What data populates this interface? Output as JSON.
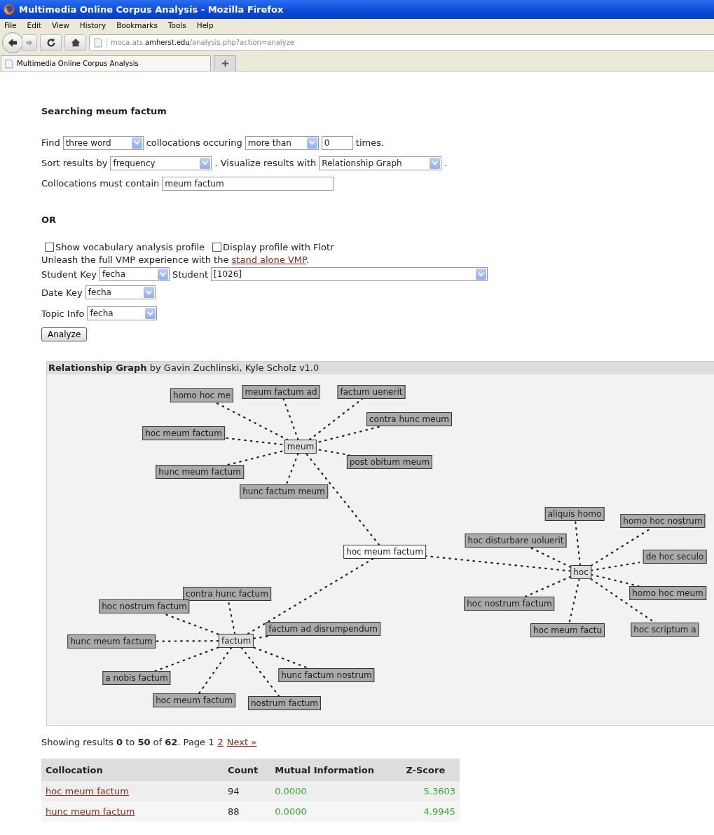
{
  "window": {
    "title": "Multimedia Online Corpus Analysis - Mozilla Firefox"
  },
  "menu": [
    {
      "label": "File"
    },
    {
      "label": "Edit"
    },
    {
      "label": "View"
    },
    {
      "label": "History"
    },
    {
      "label": "Bookmarks"
    },
    {
      "label": "Tools"
    },
    {
      "label": "Help"
    }
  ],
  "address_bar": {
    "host_prefix": "moca.ats.",
    "domain": "amherst.edu",
    "path": "/analysis.php?action=analyze"
  },
  "tabs": [
    {
      "label": "Multimedia Online Corpus Analysis",
      "selected": true
    }
  ],
  "heading": "Searching meum factum",
  "query_rows": [
    [
      {
        "kind": "text",
        "text": "Find"
      },
      {
        "kind": "select",
        "value": "three word"
      },
      {
        "kind": "text",
        "text": "collocations occuring"
      },
      {
        "kind": "select",
        "value": "more than"
      },
      {
        "kind": "input",
        "value": "0"
      },
      {
        "kind": "text",
        "text": "times."
      }
    ],
    [
      {
        "kind": "text",
        "text": "Sort results by"
      },
      {
        "kind": "select",
        "value": "frequency"
      },
      {
        "kind": "text",
        "text": ". Visualize results with"
      },
      {
        "kind": "select",
        "value": "Relationship Graph"
      },
      {
        "kind": "text",
        "text": "."
      }
    ],
    [
      {
        "kind": "text",
        "text": "Collocations must contain"
      },
      {
        "kind": "input",
        "value": "meum factum"
      }
    ]
  ],
  "or_label": "OR",
  "checkboxes": [
    {
      "label": "Show vocabulary analysis profile",
      "checked": false
    },
    {
      "label": "Display profile with Flotr",
      "checked": false
    }
  ],
  "vmp_note": {
    "text": "Unleash the full VMP experience with the",
    "link": "stand alone VMP",
    "after": "."
  },
  "key_rows": [
    [
      {
        "kind": "text",
        "text": "Student Key"
      },
      {
        "kind": "select",
        "value": "fecha"
      },
      {
        "kind": "text",
        "text": "Student"
      },
      {
        "kind": "select",
        "value": "[1026]"
      }
    ],
    [
      {
        "kind": "text",
        "text": "Date Key"
      },
      {
        "kind": "select",
        "value": "fecha"
      }
    ],
    [
      {
        "kind": "text",
        "text": "Topic Info"
      },
      {
        "kind": "select",
        "value": "fecha"
      }
    ]
  ],
  "analyze_button": "Analyze",
  "graph": {
    "title": "Relationship Graph",
    "byline": "by Gavin Zuchlinski, Kyle Scholz v1.0",
    "center": {
      "label": "hoc meum factum"
    },
    "hubs": [
      {
        "label": "meum",
        "children": [
          "homo hoc me",
          "meum factum ad",
          "factum uenerit",
          "contra hunc meum",
          "hoc meum factum",
          "post obitum meum",
          "hunc meum factum",
          "hunc factum meum"
        ]
      },
      {
        "label": "hoc",
        "children": [
          "aliquis homo",
          "homo hoc nostrum",
          "hoc disturbare uoluerit",
          "de hoc seculo",
          "homo hoc meum",
          "hoc nostrum factum",
          "hoc meum factu",
          "hoc scriptum a"
        ]
      },
      {
        "label": "factum",
        "children": [
          "contra hunc factum",
          "hoc nostrum factum",
          "factum ad disrumpendum",
          "hunc meum factum",
          "a nobis factum",
          "hunc factum nostrum",
          "hoc meum factum",
          "nostrum factum"
        ]
      }
    ]
  },
  "results_summary": {
    "text": "Showing results **0** to **50** of **62**. Page 1",
    "links": [
      "2",
      "Next »"
    ]
  },
  "table": {
    "columns": [
      "Collocation",
      "Count",
      "Mutual Information",
      "Z-Score"
    ],
    "rows": [
      [
        "hoc meum factum",
        "94",
        "0.0000",
        "5.3603"
      ],
      [
        "hunc meum factum",
        "88",
        "0.0000",
        "4.9945"
      ]
    ]
  }
}
